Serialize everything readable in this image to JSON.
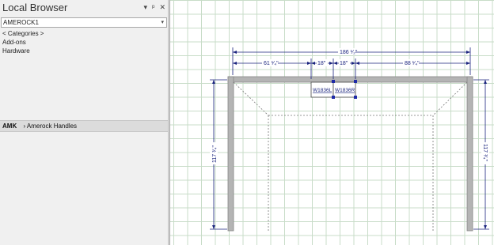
{
  "panel": {
    "title": "Local Browser",
    "controls": {
      "dropdown": "▾",
      "pin": "ᵖ",
      "close": "✕"
    },
    "library": "AMEROCK1",
    "tree": [
      {
        "label": "< Categories >"
      },
      {
        "label": "Add-ons"
      },
      {
        "label": "Hardware"
      }
    ],
    "lower_bar": {
      "prefix": "AMK",
      "item": "Amerock Handles"
    }
  },
  "drawing": {
    "dimensions": {
      "overall": "186 ¹⁄₂\"",
      "left_segment": "61 ¹⁄₄\"",
      "seg_1": "18\"",
      "seg_2": "18\"",
      "right_segment": "88 ¹⁄₄\"",
      "left_height": "117 ³⁄₄\"",
      "right_height": "117 ³⁄₄\""
    },
    "cabinets": [
      {
        "label": "W1836L"
      },
      {
        "label": "W1836R"
      }
    ]
  },
  "colors": {
    "dim": "#1a237e",
    "wall": "#b4b4b4",
    "grid": "#c8dcc8"
  }
}
